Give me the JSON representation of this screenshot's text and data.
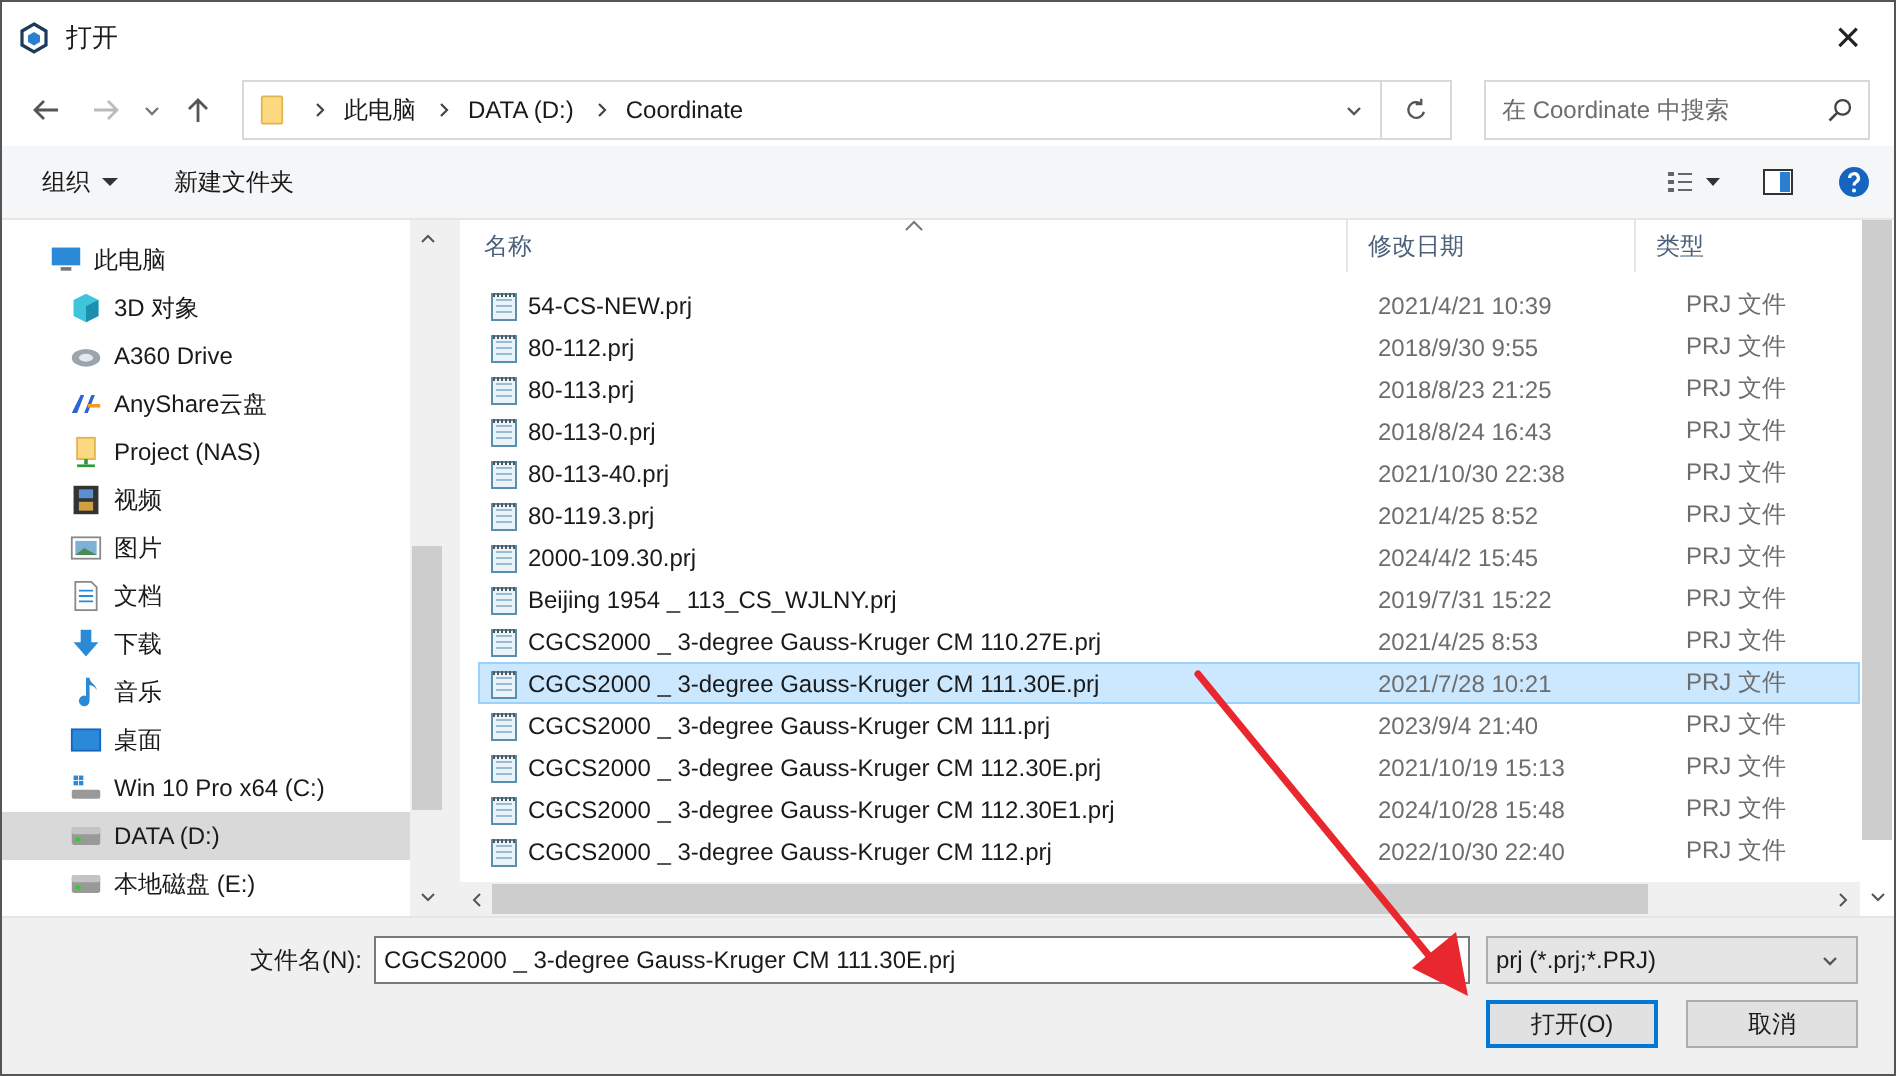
{
  "window": {
    "title": "打开",
    "close": "×"
  },
  "address": {
    "path": [
      {
        "label": "此电脑"
      },
      {
        "label": "DATA (D:)"
      },
      {
        "label": "Coordinate"
      }
    ]
  },
  "search": {
    "placeholder": "在 Coordinate 中搜索"
  },
  "toolbar": {
    "items": [
      {
        "label": "组织",
        "kind": "menu"
      },
      {
        "label": "新建文件夹",
        "kind": "plain"
      }
    ]
  },
  "sidebar": {
    "items": [
      {
        "label": "此电脑",
        "kind": "pc",
        "selected": false,
        "children": [
          {
            "label": "3D 对象",
            "kind": "cube",
            "selected": false
          },
          {
            "label": "A360 Drive",
            "kind": "cloud",
            "selected": false
          },
          {
            "label": "AnyShare云盘",
            "kind": "share",
            "selected": false
          },
          {
            "label": "Project (NAS)",
            "kind": "nas",
            "selected": false
          },
          {
            "label": "视频",
            "kind": "video",
            "selected": false
          },
          {
            "label": "图片",
            "kind": "image",
            "selected": false
          },
          {
            "label": "文档",
            "kind": "doc",
            "selected": false
          },
          {
            "label": "下载",
            "kind": "download",
            "selected": false
          },
          {
            "label": "音乐",
            "kind": "music",
            "selected": false
          },
          {
            "label": "桌面",
            "kind": "desktop",
            "selected": false
          },
          {
            "label": "Win 10 Pro x64 (C:)",
            "kind": "winDrive",
            "selected": false
          },
          {
            "label": "DATA (D:)",
            "kind": "drive",
            "selected": true
          },
          {
            "label": "本地磁盘 (E:)",
            "kind": "drive",
            "selected": false
          }
        ]
      }
    ]
  },
  "table": {
    "columns": [
      "名称",
      "修改日期",
      "类型"
    ],
    "rows": [
      {
        "name": "54-CS-NEW.prj",
        "date": "2021/4/21 10:39",
        "type": "PRJ 文件",
        "selected": false
      },
      {
        "name": "80-112.prj",
        "date": "2018/9/30 9:55",
        "type": "PRJ 文件",
        "selected": false
      },
      {
        "name": "80-113.prj",
        "date": "2018/8/23 21:25",
        "type": "PRJ 文件",
        "selected": false
      },
      {
        "name": "80-113-0.prj",
        "date": "2018/8/24 16:43",
        "type": "PRJ 文件",
        "selected": false
      },
      {
        "name": "80-113-40.prj",
        "date": "2021/10/30 22:38",
        "type": "PRJ 文件",
        "selected": false
      },
      {
        "name": "80-119.3.prj",
        "date": "2021/4/25 8:52",
        "type": "PRJ 文件",
        "selected": false
      },
      {
        "name": "2000-109.30.prj",
        "date": "2024/4/2 15:45",
        "type": "PRJ 文件",
        "selected": false
      },
      {
        "name": "Beijing 1954 _ 113_CS_WJLNY.prj",
        "date": "2019/7/31 15:22",
        "type": "PRJ 文件",
        "selected": false
      },
      {
        "name": "CGCS2000 _ 3-degree Gauss-Kruger CM 110.27E.prj",
        "date": "2021/4/25 8:53",
        "type": "PRJ 文件",
        "selected": false
      },
      {
        "name": "CGCS2000 _ 3-degree Gauss-Kruger CM 111.30E.prj",
        "date": "2021/7/28 10:21",
        "type": "PRJ 文件",
        "selected": true
      },
      {
        "name": "CGCS2000 _ 3-degree Gauss-Kruger CM 111.prj",
        "date": "2023/9/4 21:40",
        "type": "PRJ 文件",
        "selected": false
      },
      {
        "name": "CGCS2000 _ 3-degree Gauss-Kruger CM 112.30E.prj",
        "date": "2021/10/19 15:13",
        "type": "PRJ 文件",
        "selected": false
      },
      {
        "name": "CGCS2000 _ 3-degree Gauss-Kruger CM 112.30E1.prj",
        "date": "2024/10/28 15:48",
        "type": "PRJ 文件",
        "selected": false
      },
      {
        "name": "CGCS2000 _ 3-degree Gauss-Kruger CM 112.prj",
        "date": "2022/10/30 22:40",
        "type": "PRJ 文件",
        "selected": false
      }
    ]
  },
  "filename": {
    "label": "文件名(N):",
    "value": "CGCS2000 _ 3-degree Gauss-Kruger CM 111.30E.prj"
  },
  "filter": {
    "value": "prj (*.prj;*.PRJ)"
  },
  "buttons": [
    {
      "label": "打开(O)",
      "kind": "primary"
    },
    {
      "label": "取消",
      "kind": "normal"
    }
  ]
}
